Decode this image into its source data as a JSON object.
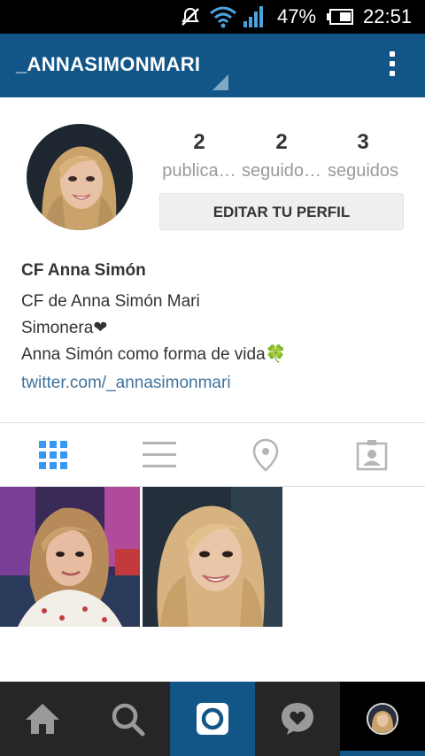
{
  "status_bar": {
    "battery_percent": "47%",
    "time": "22:51"
  },
  "header": {
    "username": "_ANNASIMONMARI"
  },
  "profile": {
    "stats": [
      {
        "count": "2",
        "label": "publica…"
      },
      {
        "count": "2",
        "label": "seguido…"
      },
      {
        "count": "3",
        "label": "seguidos"
      }
    ],
    "edit_button": "EDITAR TU PERFIL",
    "full_name": "CF Anna Simón",
    "bio_lines": [
      "CF de Anna Simón Mari",
      "Simonera❤",
      "Anna Simón como forma de vida🍀"
    ],
    "website": "twitter.com/_annasimonmari"
  },
  "tabs": [
    {
      "icon": "grid-icon",
      "active": true
    },
    {
      "icon": "list-icon",
      "active": false
    },
    {
      "icon": "location-pin-icon",
      "active": false
    },
    {
      "icon": "tagged-photos-icon",
      "active": false
    }
  ],
  "bottom_nav": [
    {
      "icon": "home-icon"
    },
    {
      "icon": "search-icon"
    },
    {
      "icon": "camera-icon"
    },
    {
      "icon": "activity-heart-icon"
    },
    {
      "icon": "profile-avatar"
    }
  ],
  "colors": {
    "brand_blue": "#125688",
    "active_tab_blue": "#3897f0",
    "link_blue": "#3f729b",
    "nav_background": "#262626"
  }
}
